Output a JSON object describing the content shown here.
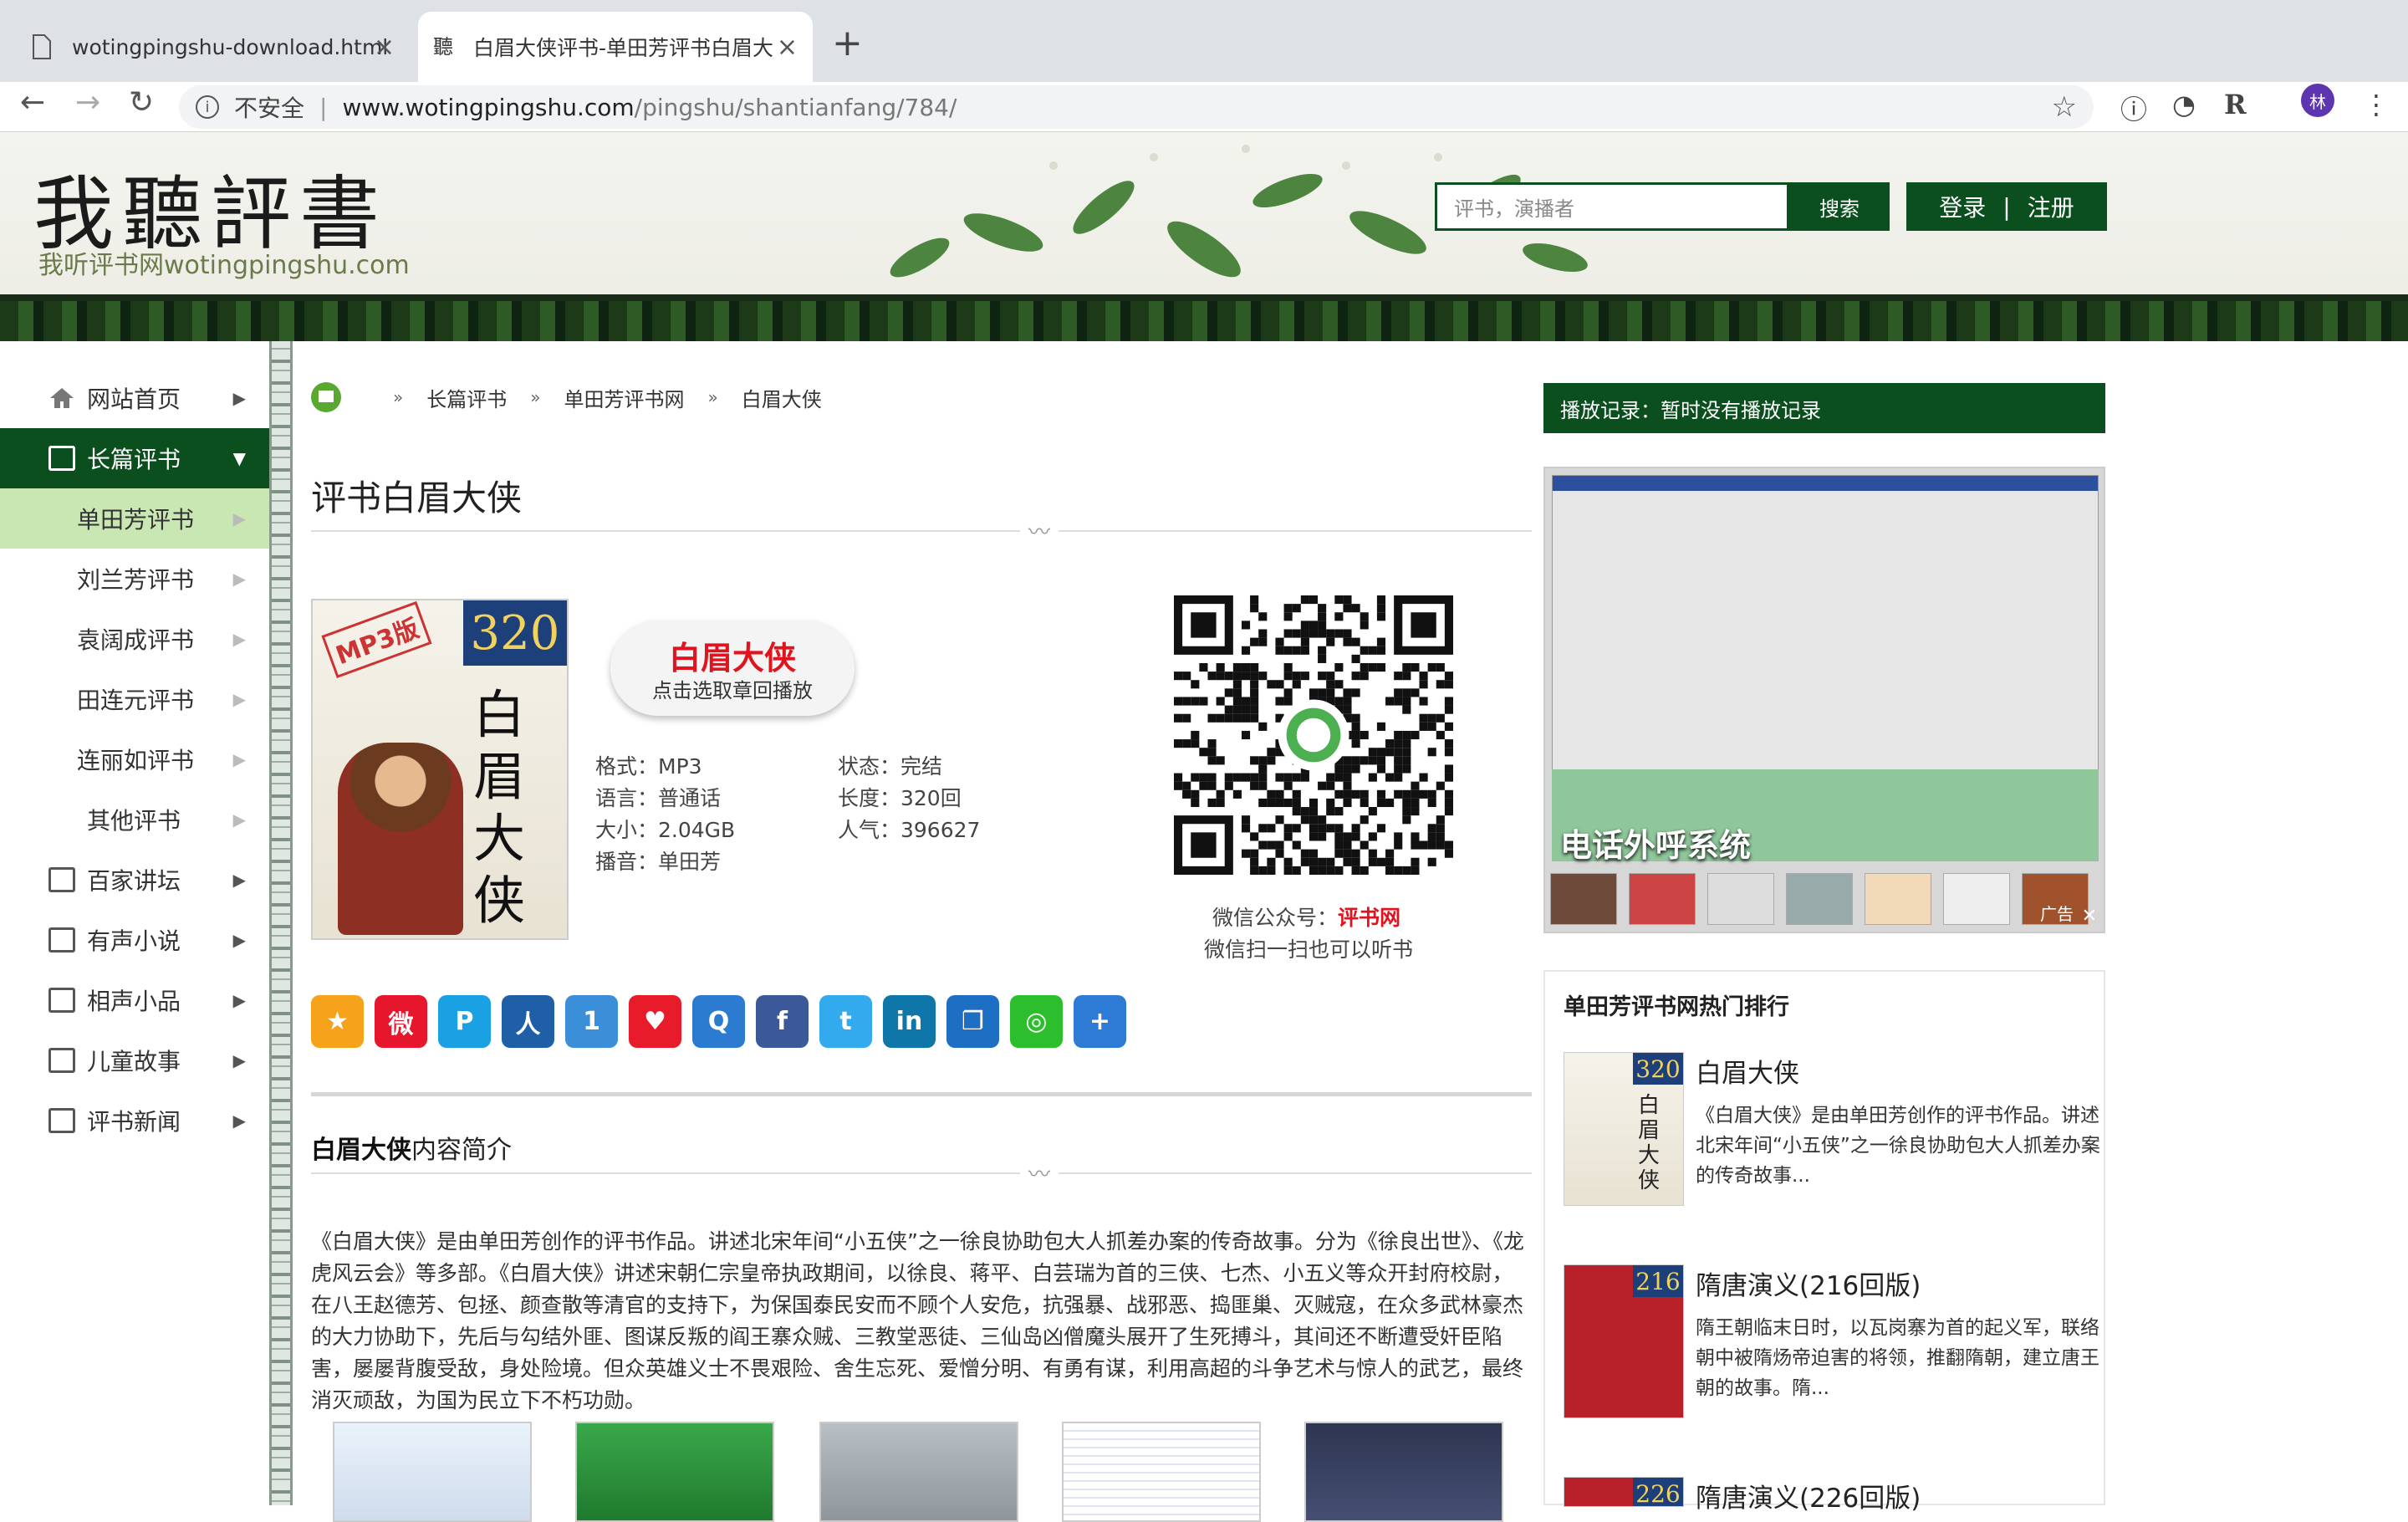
{
  "browser": {
    "tabs": [
      {
        "title": "wotingpingshu-download.html",
        "active": false
      },
      {
        "title": "白眉大侠评书-单田芳评书白眉大",
        "active": true
      }
    ],
    "url_host": "www.wotingpingshu.com",
    "url_path": "/pingshu/shantianfang/784/",
    "security_label": "不安全",
    "profile_initial": "林"
  },
  "header": {
    "logo_title": "我聽評書",
    "logo_subtitle": "我听评书网wotingpingshu.com",
    "search_placeholder": "评书，演播者",
    "search_button": "搜索",
    "login": "登录",
    "login_sep": "|",
    "register": "注册"
  },
  "sidebar": {
    "items": [
      {
        "label": "网站首页"
      },
      {
        "label": "长篇评书"
      },
      {
        "label": "单田芳评书"
      },
      {
        "label": "刘兰芳评书"
      },
      {
        "label": "袁阔成评书"
      },
      {
        "label": "田连元评书"
      },
      {
        "label": "连丽如评书"
      },
      {
        "label": "其他评书"
      },
      {
        "label": "百家讲坛"
      },
      {
        "label": "有声小说"
      },
      {
        "label": "相声小品"
      },
      {
        "label": "儿童故事"
      },
      {
        "label": "评书新闻"
      }
    ]
  },
  "breadcrumb": [
    "长篇评书",
    "单田芳评书网",
    "白眉大侠"
  ],
  "breadcrumb_sep": "»",
  "page_title": "评书白眉大侠",
  "book": {
    "cover_badge": "MP3版",
    "cover_number": "320",
    "cover_title": "白眉大侠",
    "play_title": "白眉大侠",
    "play_sub": "点击选取章回播放",
    "format": "格式：MP3",
    "language": "语言：普通话",
    "size": "大小：2.04GB",
    "narrator": "播音：单田芳",
    "status": "状态：完结",
    "length": "长度：320回",
    "popularity": "人气：396627"
  },
  "qr": {
    "caption_prefix": "微信公众号：",
    "caption_name": "评书网",
    "caption2": "微信扫一扫也可以听书"
  },
  "intro": {
    "title_bold": "白眉大侠",
    "title_rest": "内容简介",
    "text": "《白眉大侠》是由单田芳创作的评书作品。讲述北宋年间“小五侠”之一徐良协助包大人抓差办案的传奇故事。分为《徐良出世》、《龙虎风云会》等多部。《白眉大侠》讲述宋朝仁宗皇帝执政期间，以徐良、蒋平、白芸瑞为首的三侠、七杰、小五义等众开封府校尉，在八王赵德芳、包拯、颜查散等清官的支持下，为保国泰民安而不顾个人安危，抗强暴、战邪恶、捣匪巢、灭贼寇，在众多武林豪杰的大力协助下，先后与勾结外匪、图谋反叛的阎王寨众贼、三教堂恶徒、三仙岛凶僧魔头展开了生死搏斗，其间还不断遭受奸臣陷害，屡屡背腹受敌，身处险境。但众英雄义士不畏艰险、舍生忘死、爱憎分明、有勇有谋，利用高超的斗争艺术与惊人的武艺，最终消灭顽敌，为国为民立下不朽功勋。"
  },
  "right": {
    "history": "播放记录：暂时没有播放记录",
    "ad_title": "电话外呼系统",
    "ad_label": "广告",
    "ad_close": "✕",
    "rank_title": "单田芳评书网热门排行",
    "rank": [
      {
        "name": "白眉大侠",
        "num": "320",
        "desc": "《白眉大侠》是由单田芳创作的评书作品。讲述北宋年间“小五侠”之一徐良协助包大人抓差办案的传奇故事..."
      },
      {
        "name": "隋唐演义(216回版)",
        "num": "216",
        "desc": "隋王朝临末日时，以瓦岗寨为首的起义军，联络朝中被隋炀帝迫害的将领，推翻隋朝，建立唐王朝的故事。隋..."
      },
      {
        "name": "隋唐演义(226回版)",
        "num": "226",
        "desc": ""
      }
    ]
  },
  "colors": {
    "brand_green": "#0b4f1e",
    "accent_red": "#e0141e",
    "sub_active": "#c9e7b3"
  }
}
